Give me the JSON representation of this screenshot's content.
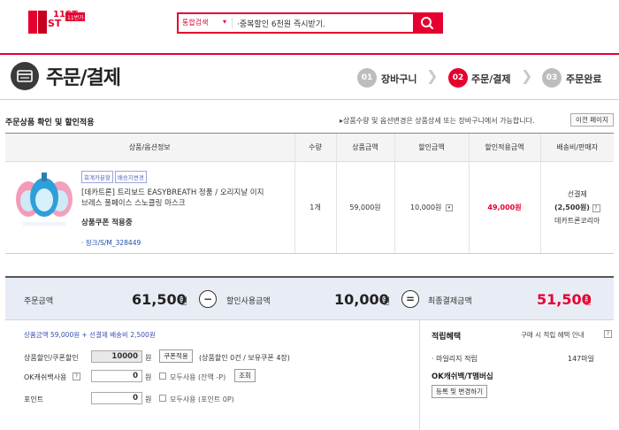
{
  "header": {
    "logo_text": "11ST",
    "logo_small": "11번가",
    "search": {
      "category": "통합검색",
      "value": "·중복할인 6천원 즉시받기."
    }
  },
  "page": {
    "title": "주문/결제",
    "steps": [
      {
        "num": "01",
        "label": "장바구니",
        "active": false
      },
      {
        "num": "02",
        "label": "주문/결제",
        "active": true
      },
      {
        "num": "03",
        "label": "주문완료",
        "active": false
      }
    ]
  },
  "order": {
    "section_title": "주문상품 확인 및 할인적용",
    "note": "▸상품수량 및 옵션변경은 상품상세 또는 장바구니에서 가능합니다.",
    "prev_page_label": "이전 페이지",
    "columns": [
      "상품/옵션정보",
      "수량",
      "상품금액",
      "할인금액",
      "할인적용금액",
      "배송비/판매자"
    ],
    "item": {
      "badges": [
        "회계카분할",
        "배송지변경"
      ],
      "name": "[데카트론] 트리보드 EASYBREATH 정품 / 오리지날 이지브레스 풀페이스 스노클링 마스크",
      "coupon_status": "상품쿠폰 적용중",
      "option": "· 핑크/S/M_328449",
      "quantity": "1개",
      "price": "59,000원",
      "discount": "10,000원",
      "discounted_price": "49,000원",
      "shipping_type": "선결제",
      "shipping_fee": "(2,500원)",
      "seller": "데카트론코리아"
    }
  },
  "summary": {
    "order_amount_label": "주문금액",
    "order_amount": "61,500",
    "discount_label": "할인사용금액",
    "discount_amount": "10,000",
    "final_label": "최종결제금액",
    "final_amount": "51,500",
    "unit": "원",
    "minus": "−",
    "equals": "=",
    "breakdown": "상품금액 59,000원 + 선결제 배송비 2,500원"
  },
  "discounts": {
    "coupon_label": "상품할인/쿠폰할인",
    "coupon_value": "10000",
    "coupon_unit": "원",
    "coupon_btn": "쿠폰적용",
    "coupon_info": "(상품할인 0건 / 보유쿠폰 4장)",
    "ok_label": "OK캐쉬백사용",
    "ok_value": "0",
    "ok_unit": "원",
    "ok_all": "모두사용 (잔액 -P)",
    "ok_check_btn": "조회",
    "point_label": "포인트",
    "point_value": "0",
    "point_unit": "원",
    "point_all": "모두사용 (포인트 0P)"
  },
  "benefits": {
    "title": "적립혜택",
    "note": "구매 시 적립 혜택 안내",
    "mileage_label": "· 마일리지 적립",
    "mileage_value": "147마일",
    "ok_title": "OK캐쉬백/T멤버십",
    "register_btn": "등록 및 변경하기"
  },
  "colors": {
    "brand": "#e5002f",
    "option_link": "#1b4fa8"
  }
}
